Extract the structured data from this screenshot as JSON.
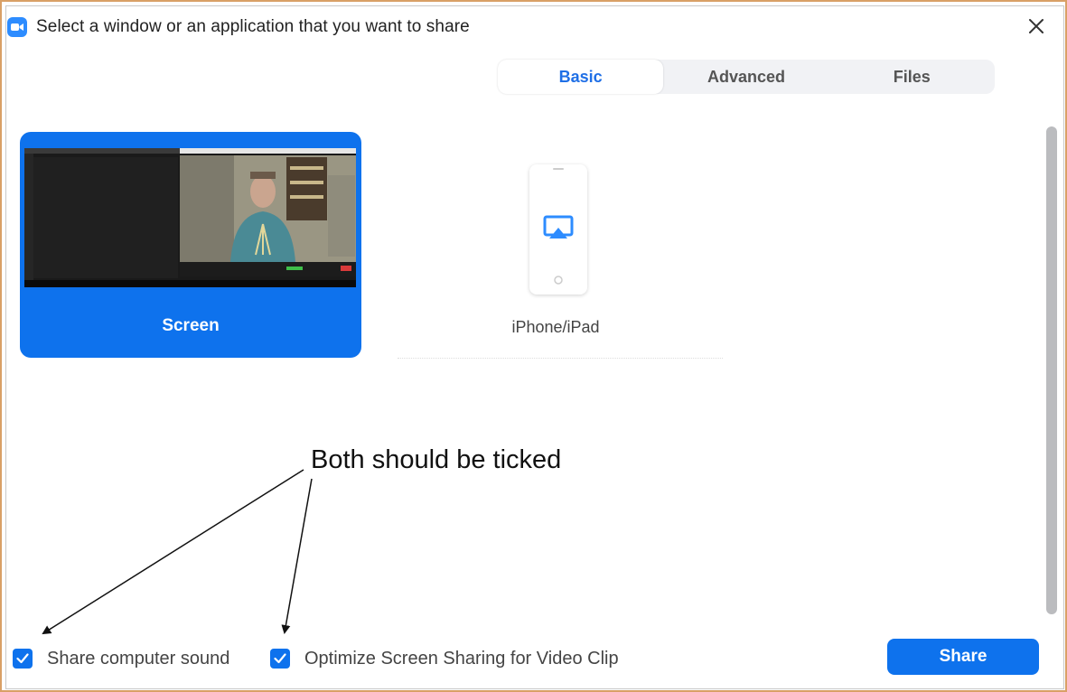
{
  "window": {
    "title": "Select a window or an application that you want to share",
    "app_icon": "zoom-camera-icon",
    "close_icon": "close-icon"
  },
  "tabs": [
    {
      "label": "Basic",
      "active": true
    },
    {
      "label": "Advanced",
      "active": false
    },
    {
      "label": "Files",
      "active": false
    }
  ],
  "options": {
    "screen": {
      "label": "Screen",
      "selected": true
    },
    "iphone": {
      "label": "iPhone/iPad",
      "selected": false,
      "icon": "airplay-icon"
    }
  },
  "annotation": {
    "text": "Both should be ticked"
  },
  "checkboxes": [
    {
      "label": "Share computer sound",
      "checked": true
    },
    {
      "label": "Optimize Screen Sharing for Video Clip",
      "checked": true
    }
  ],
  "share_button": {
    "label": "Share"
  },
  "colors": {
    "accent": "#0e72ed",
    "active_tab_text": "#1f6fe6",
    "tab_bg": "#f1f2f5",
    "outer_border": "#d9a066"
  }
}
